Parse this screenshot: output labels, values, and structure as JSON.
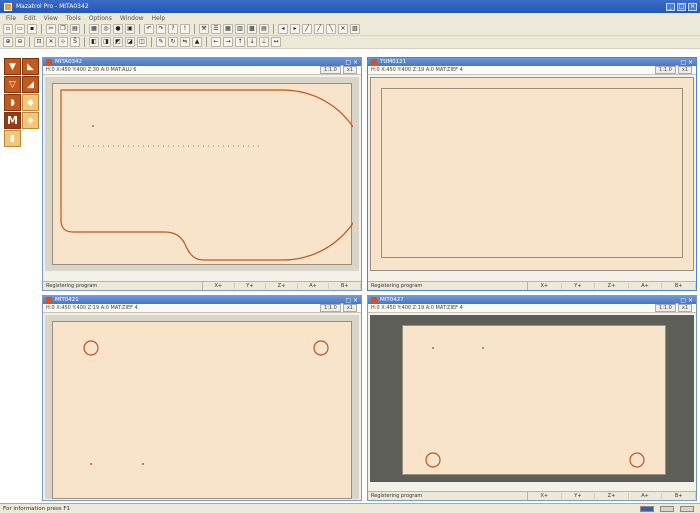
{
  "app": {
    "title": "Mazatrol Pro - MITA0342",
    "window_controls": [
      "_",
      "□",
      "×"
    ]
  },
  "menu": [
    "File",
    "Edit",
    "View",
    "Tools",
    "Options",
    "Window",
    "Help"
  ],
  "toolbar1": [
    "new-file-icon",
    "open-folder-icon",
    "save-icon",
    "cut-icon",
    "copy-icon",
    "paste-icon",
    "print-icon",
    "preview-icon",
    "undo-icon",
    "redo-icon",
    "help-icon",
    "info-icon"
  ],
  "toolbar2": [
    "zoom-in-icon",
    "zoom-out-icon",
    "fit-icon",
    "grid-icon",
    "layer-icon",
    "draw-icon",
    "rotate-icon",
    "mirror-icon",
    "measure-icon"
  ],
  "windows": [
    {
      "title": "MITA0342",
      "info": "H:0 X:450 Y:400 Z:30 A:0 MAT:ALU 6",
      "zoom_buttons": [
        "1:1.0",
        "x1"
      ],
      "status_msg": "Registering program",
      "status_cells": [
        "X+",
        "Y+",
        "Z+",
        "A+",
        "B+"
      ]
    },
    {
      "title": "TUM0121",
      "info": "H:0 X:450 Y:400 Z:19 A:0 MAT:ZIEF 4",
      "zoom_buttons": [
        "1:1.0",
        "x1"
      ],
      "status_msg": "Registering program",
      "status_cells": [
        "X+",
        "Y+",
        "Z+",
        "A+",
        "B+"
      ]
    },
    {
      "title": "MIT0421",
      "info": "H:0 X:450 Y:400 Z:19 A:0 MAT:ZIEF 4",
      "zoom_buttons": [
        "1:1.0",
        "x1"
      ],
      "status_msg": "",
      "status_cells": []
    },
    {
      "title": "MIT0427",
      "info": "H:0 X:450 Y:400 Z:19 A:0 MAT:ZIEF 4",
      "zoom_buttons": [
        "1:1.0",
        "x1"
      ],
      "status_msg": "Registering program",
      "status_cells": [
        "X+",
        "Y+",
        "Z+",
        "A+",
        "B+"
      ]
    }
  ],
  "app_status": "For information press F1",
  "colors": {
    "part_fill": "#f7e4cb",
    "contour": "#c2561c",
    "title_blue": "#2656b4",
    "palette_orange": "#c25a1c"
  }
}
